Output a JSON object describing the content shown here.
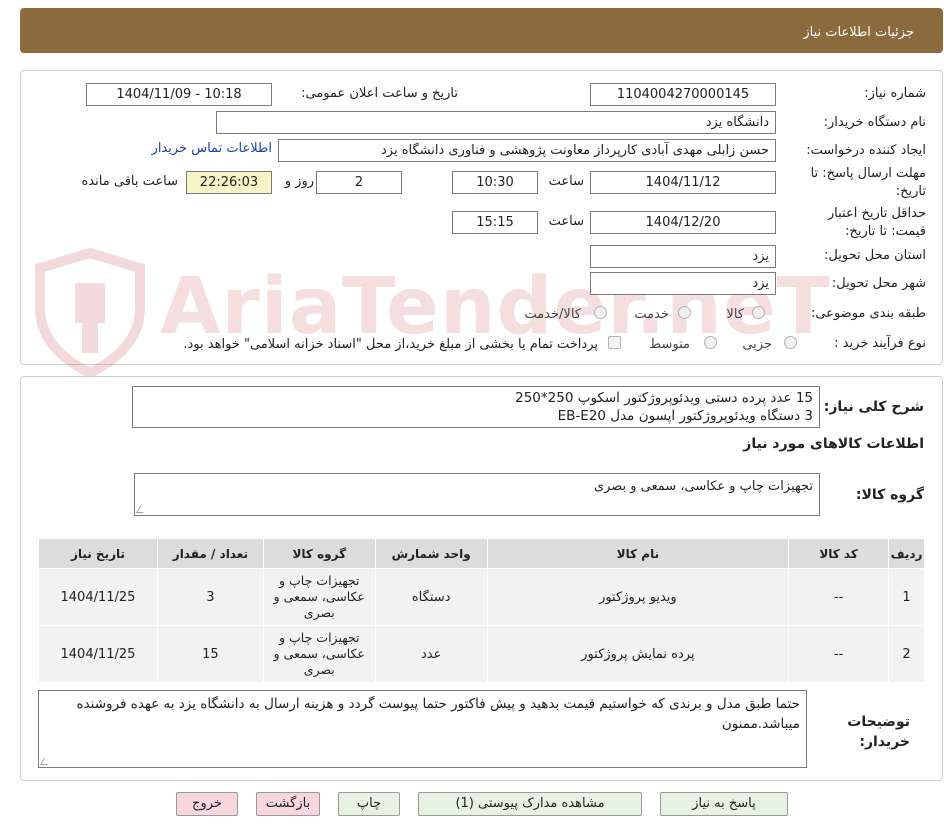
{
  "header": {
    "title": "جزئیات اطلاعات نیاز"
  },
  "watermark": {
    "text": "AriaTender.neT"
  },
  "fields": {
    "need_number_label": "شماره نیاز:",
    "need_number": "1104004270000145",
    "announce_label": "تاریخ و ساعت اعلان عمومی:",
    "announce_value": "1404/11/09 - 10:18",
    "buyer_org_label": "نام دستگاه خریدار:",
    "buyer_org": "دانشگاه یزد",
    "requester_label": "ایجاد کننده درخواست:",
    "requester": "حسن زابلی مهدی آبادی کارپرداز معاونت پژوهشی و فناوری دانشگاه یزد",
    "contact_link": "اطلاعات تماس خریدار",
    "deadline_label": "مهلت ارسال پاسخ: تا تاریخ:",
    "deadline_date": "1404/11/12",
    "time_label": "ساعت",
    "deadline_time": "10:30",
    "days_value": "2",
    "days_label": "روز و",
    "remaining_time": "22:26:03",
    "remaining_label": "ساعت باقی مانده",
    "validity_label": "حداقل تاریخ اعتبار قیمت: تا تاریخ:",
    "validity_date": "1404/12/20",
    "validity_time": "15:15",
    "province_label": "استان محل تحویل:",
    "province": "یزد",
    "city_label": "شهر محل تحویل:",
    "city": "یزد",
    "category_label": "طبقه بندی موضوعی:",
    "category_options": [
      "کالا",
      "خدمت",
      "کالا/خدمت"
    ],
    "process_label": "نوع فرآیند خرید :",
    "process_options": [
      "جزیی",
      "متوسط"
    ],
    "payment_note": "پرداخت تمام یا بخشی از مبلغ خرید،از محل \"اسناد خزانه اسلامی\" خواهد بود."
  },
  "summary": {
    "label": "شرح کلی نیاز:",
    "line1": "15 عدد پرده دستی ویدئوپروژکتور اسکوپ 250*250",
    "line2": "3 دستگاه ویدئوپروژکتور اپسون مدل EB-E20"
  },
  "goods_section": {
    "title": "اطلاعات کالاهای مورد نیاز",
    "group_label": "گروه کالا:",
    "group_value": "تجهیزات چاپ و عکاسی، سمعی و بصری"
  },
  "table": {
    "headers": [
      "ردیف",
      "کد کالا",
      "نام کالا",
      "واحد شمارش",
      "گروه کالا",
      "تعداد / مقدار",
      "تاریخ نیاز"
    ],
    "rows": [
      [
        "1",
        "--",
        "ویدیو پروژکتور",
        "دستگاه",
        "تجهیزات چاپ و عکاسی، سمعی و بصری",
        "3",
        "1404/11/25"
      ],
      [
        "2",
        "--",
        "پرده نمایش پروژکتور",
        "عدد",
        "تجهیزات چاپ و عکاسی، سمعی و بصری",
        "15",
        "1404/11/25"
      ]
    ]
  },
  "notes": {
    "label": "توضیحات خریدار:",
    "text": "حتما طبق مدل و برندی که خواستیم قیمت بدهید و پیش فاکتور حتما پیوست گردد و هزینه ارسال به دانشگاه یزد به عهده فروشنده میباشد.ممنون"
  },
  "buttons": {
    "reply": "پاسخ به نیاز",
    "attachments": "مشاهده مدارک پیوستی (1)",
    "print": "چاپ",
    "back": "بازگشت",
    "exit": "خروج"
  },
  "colors": {
    "header": "#8b6a3e",
    "link": "#1b3fb5",
    "button_green": "#e7f3e2",
    "button_pink": "#f8d7dc",
    "remaining_bg": "#f6f3c6"
  }
}
